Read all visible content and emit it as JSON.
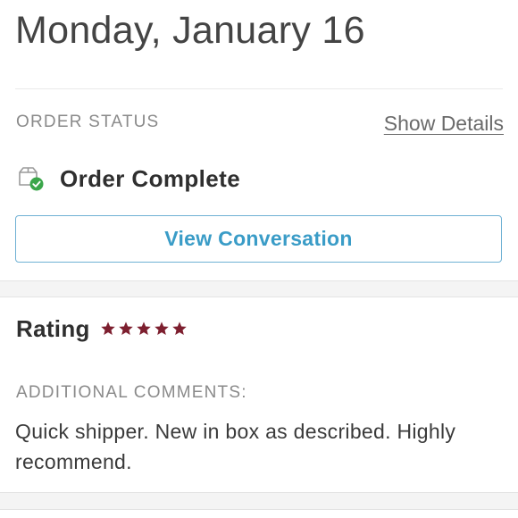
{
  "header": {
    "date": "Monday, January 16"
  },
  "order_status": {
    "label": "ORDER STATUS",
    "show_details": "Show Details",
    "status": "Order Complete",
    "view_conversation": "View Conversation"
  },
  "rating": {
    "label": "Rating",
    "stars": 5,
    "star_color": "#7d1f2f"
  },
  "comments": {
    "label": "ADDITIONAL COMMENTS:",
    "text": "Quick shipper. New in box as described. Highly recommend."
  },
  "colors": {
    "button_border": "#6fb1d4",
    "button_text": "#3a9cc7",
    "check_green": "#3aa64a"
  }
}
